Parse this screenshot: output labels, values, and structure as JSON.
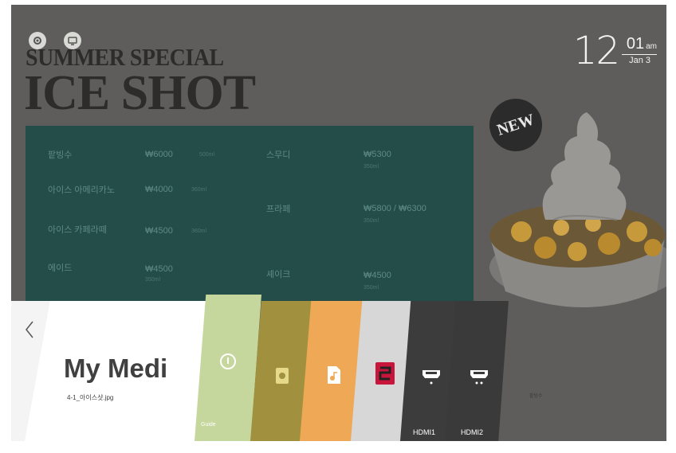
{
  "poster": {
    "headline_1": "SUMMER SPECIAL",
    "headline_2": "ICE SHOT",
    "badge": "NEW",
    "side_caption": "팥빙수"
  },
  "clock": {
    "hour": "12",
    "minutes": "01",
    "ampm": "am",
    "date": "Jan 3"
  },
  "menu_board": {
    "items": [
      {
        "name": "팥빙수",
        "price": "₩6000",
        "note": "500ml"
      },
      {
        "name": "아이스 아메리카노",
        "price": "₩4000",
        "note": "360ml"
      },
      {
        "name": "아이스 카페라떼",
        "price": "₩4500",
        "note": "360ml"
      },
      {
        "name": "에이드",
        "price": "₩4500",
        "note": "350ml"
      },
      {
        "name": "스무디",
        "price": "₩5300",
        "note": "350ml"
      },
      {
        "name": "프라페",
        "price": "₩5800 / ₩6300",
        "note": "350ml"
      },
      {
        "name": "셰이크",
        "price": "₩4500",
        "note": "350ml"
      }
    ]
  },
  "launcher": {
    "back_icon": "chevron-left-icon",
    "my_media_title": "My Medi",
    "my_media_file": "4-1_아이스샷.jpg",
    "card_green_label": "Guide",
    "hdmi1_label": "HDMI1",
    "hdmi2_label": "HDMI2"
  },
  "colors": {
    "screen_bg": "#5f5d5b",
    "menu_board": "#244c48",
    "card_green": "#c5d79c",
    "card_olive": "#a1913e",
    "card_orange": "#eea856",
    "card_grey": "#d7d7d7",
    "card_hdmi": "#3c3c3c"
  }
}
